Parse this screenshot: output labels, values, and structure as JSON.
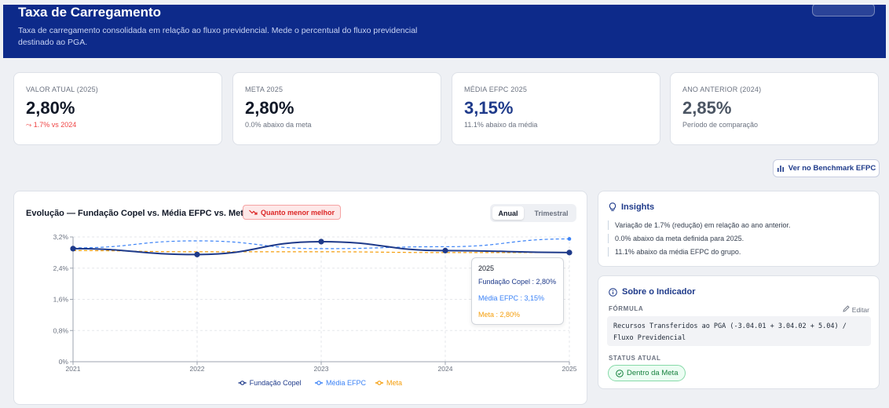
{
  "header": {
    "title": "Taxa de Carregamento",
    "description": "Taxa de carregamento consolidada em relação ao fluxo previdencial. Mede o percentual do fluxo previdencial destinado ao PGA."
  },
  "kpis": [
    {
      "label": "VALOR ATUAL (2025)",
      "value": "2,80%",
      "sub": "⤳ 1.7% vs 2024",
      "value_color": "#111827",
      "sub_color": "#ef4444"
    },
    {
      "label": "META 2025",
      "value": "2,80%",
      "sub": "0.0% abaixo da meta",
      "value_color": "#111827"
    },
    {
      "label": "MÉDIA EFPC 2025",
      "value": "3,15%",
      "sub": "11.1% abaixo da média",
      "value_color": "#1e3a8a"
    },
    {
      "label": "ANO ANTERIOR (2024)",
      "value": "2,85%",
      "sub": "Período de comparação",
      "value_color": "#4b5563"
    }
  ],
  "benchmark_button": {
    "icon": "bar-chart-icon",
    "label": "Ver no Benchmark EFPC"
  },
  "chart_card": {
    "title": "Evolução — Fundação Copel vs. Média EFPC vs. Meta",
    "badge": "Quanto menor melhor",
    "badge_icon": "trend-down-icon",
    "toggle": {
      "active": "Anual",
      "inactive": "Trimestral"
    },
    "tooltip": {
      "title": "2025",
      "rows": [
        {
          "text": "Fundação Copel : 2,80%",
          "color": "#1e3a8a"
        },
        {
          "text": "Média EFPC : 3,15%",
          "color": "#3b82f6"
        },
        {
          "text": "Meta : 2,80%",
          "color": "#f59e0b"
        }
      ]
    }
  },
  "chart_data": {
    "type": "line",
    "x": [
      "2021",
      "2022",
      "2023",
      "2024",
      "2025"
    ],
    "y_ticks": [
      "0%",
      "0,8%",
      "1,6%",
      "2,4%",
      "3,2%"
    ],
    "ylim": [
      0,
      3.2
    ],
    "grid": true,
    "legend": "bottom",
    "series": [
      {
        "name": "Fundação Copel",
        "values": [
          2.9,
          2.75,
          3.08,
          2.85,
          2.8
        ],
        "color": "#1e3a8a",
        "style": "solid"
      },
      {
        "name": "Média EFPC",
        "values": [
          2.92,
          3.1,
          2.9,
          2.95,
          3.15
        ],
        "color": "#3b82f6",
        "style": "dashed"
      },
      {
        "name": "Meta",
        "values": [
          2.85,
          2.82,
          2.82,
          2.8,
          2.8
        ],
        "color": "#f59e0b",
        "style": "dashed"
      }
    ]
  },
  "insights": {
    "title": "Insights",
    "icon": "lightbulb-icon",
    "items": [
      "Variação de 1.7% (redução) em relação ao ano anterior.",
      "0.0% abaixo da meta definida para 2025.",
      "11.1% abaixo da média EFPC do grupo."
    ]
  },
  "about": {
    "title": "Sobre o Indicador",
    "icon": "info-icon",
    "formula_label": "FÓRMULA",
    "edit_label": "Editar",
    "formula": "Recursos Transferidos ao PGA (-3.04.01 + 3.04.02 + 5.04) / Fluxo Previdencial",
    "status_label": "STATUS ATUAL",
    "status": "Dentro da Meta"
  }
}
